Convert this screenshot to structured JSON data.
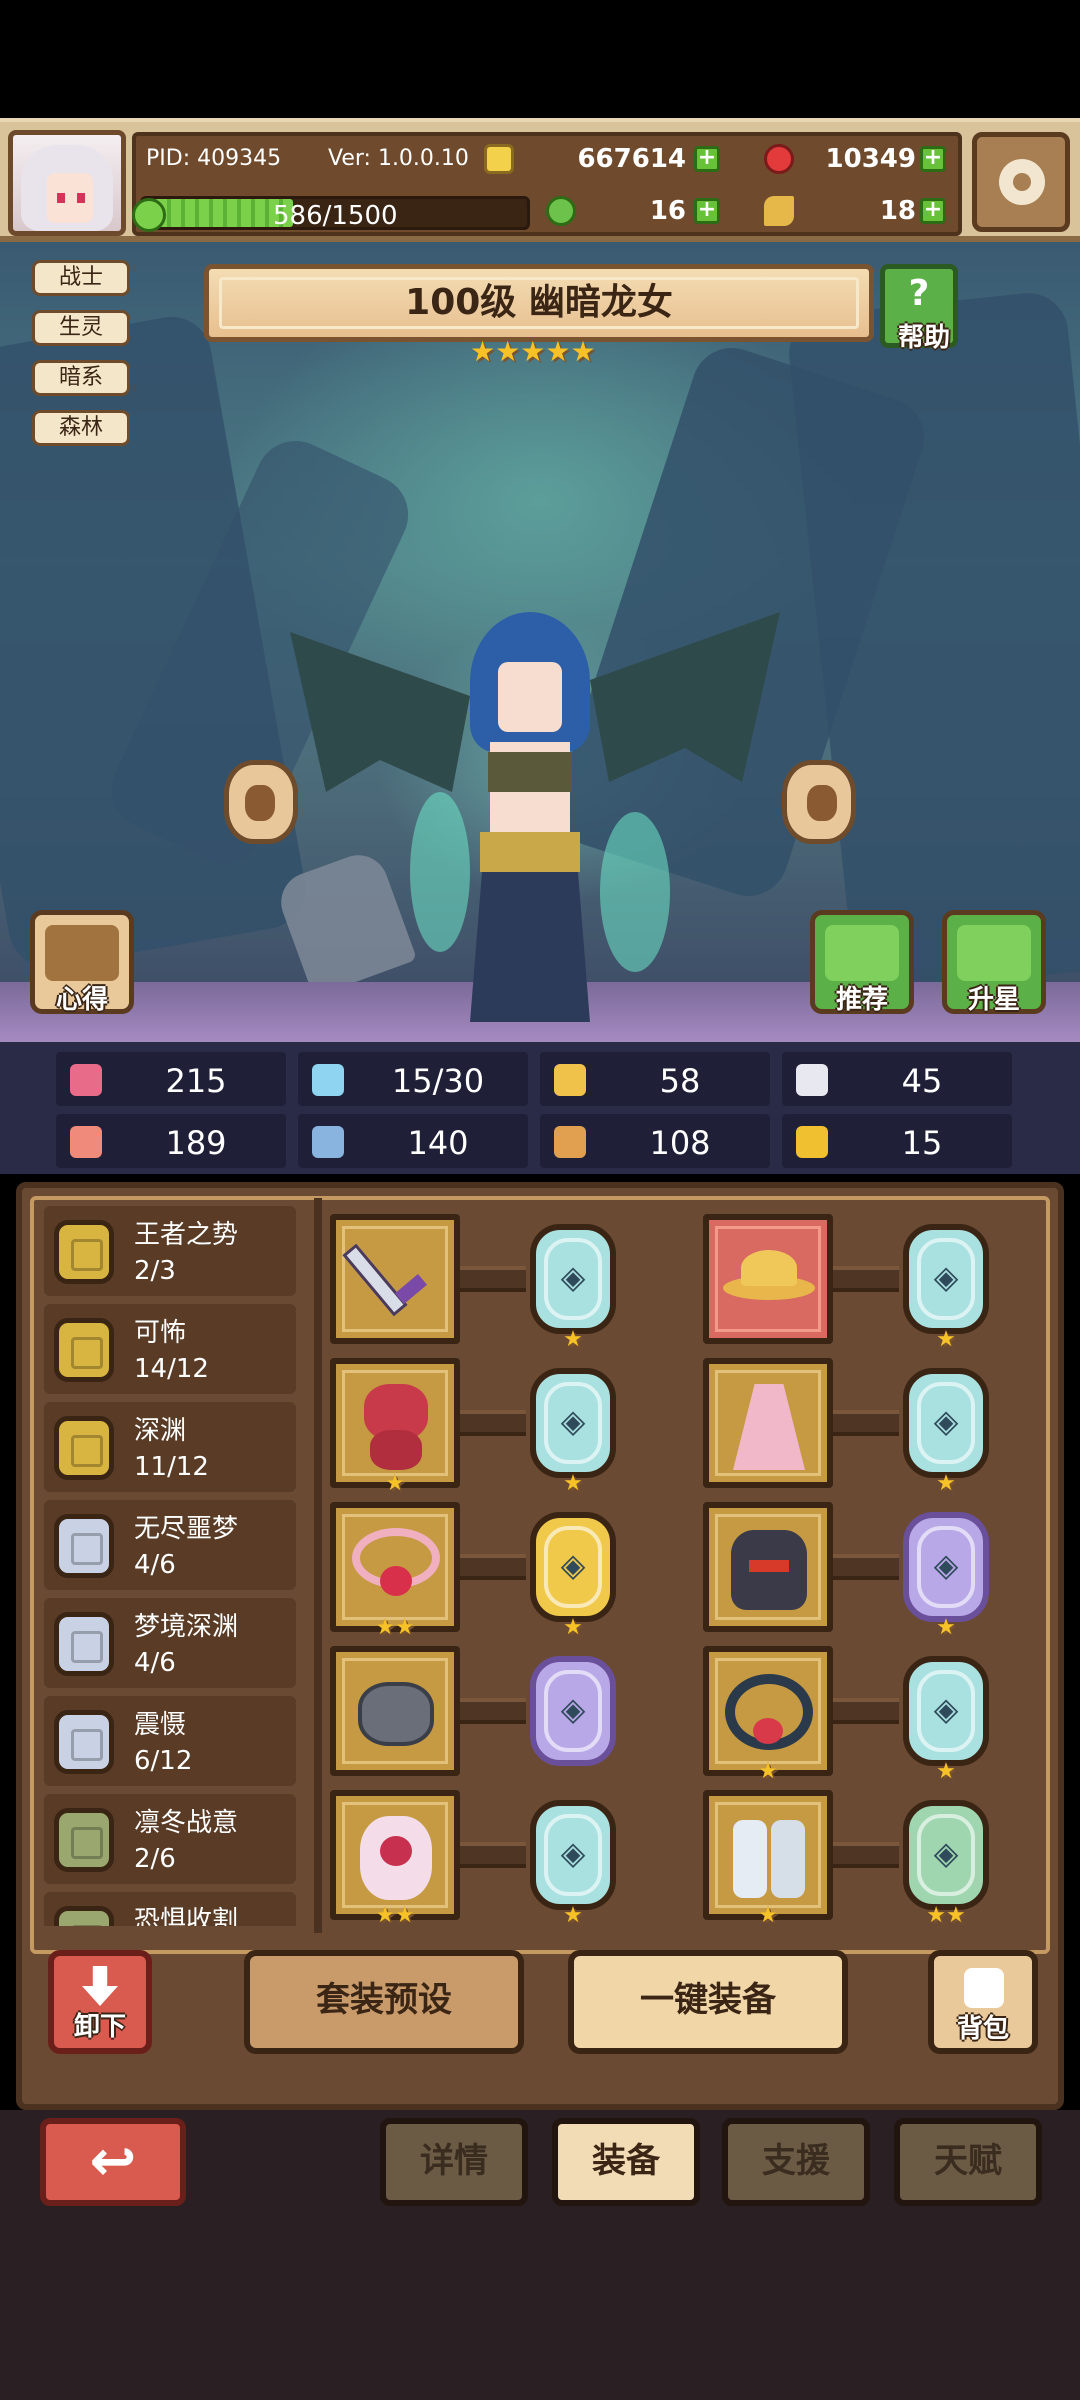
{
  "topbar": {
    "pid": "PID: 409345",
    "version": "Ver: 1.0.0.10",
    "gold": "667614",
    "gems": "10349",
    "exp_text": "586/1500",
    "exp_progress": 0.39,
    "clover": "16",
    "scroll": "18"
  },
  "hero": {
    "tags": [
      "战士",
      "生灵",
      "暗系",
      "森林"
    ],
    "title": "100级 幽暗龙女",
    "stars": 5,
    "help_label": "帮助",
    "notes_label": "心得",
    "recommend_label": "推荐",
    "starup_label": "升星"
  },
  "stats": [
    {
      "icon": "heart-icon",
      "value": "215",
      "color": "#e86b8a"
    },
    {
      "icon": "mana-drop-icon",
      "value": "15/30",
      "color": "#8fd4f0"
    },
    {
      "icon": "shield-icon",
      "value": "58",
      "color": "#f0c24a"
    },
    {
      "icon": "wing-icon",
      "value": "45",
      "color": "#e8e8f0"
    },
    {
      "icon": "fist-icon",
      "value": "189",
      "color": "#f08a7a"
    },
    {
      "icon": "book-icon",
      "value": "140",
      "color": "#8ab4e0"
    },
    {
      "icon": "boot-icon",
      "value": "108",
      "color": "#e0a050"
    },
    {
      "icon": "horseshoe-icon",
      "value": "15",
      "color": "#f0c030"
    }
  ],
  "sets": [
    {
      "name": "王者之势",
      "progress": "2/3",
      "medal": "gold"
    },
    {
      "name": "可怖",
      "progress": "14/12",
      "medal": "gold"
    },
    {
      "name": "深渊",
      "progress": "11/12",
      "medal": "gold"
    },
    {
      "name": "无尽噩梦",
      "progress": "4/6",
      "medal": "silver"
    },
    {
      "name": "梦境深渊",
      "progress": "4/6",
      "medal": "silver"
    },
    {
      "name": "震慑",
      "progress": "6/12",
      "medal": "silver"
    },
    {
      "name": "凛冬战意",
      "progress": "2/6",
      "medal": "green"
    },
    {
      "name": "恐惧收割",
      "progress": "",
      "medal": "green"
    }
  ],
  "equipment": [
    {
      "item": "sword",
      "item_stars": 0,
      "gem": "ice",
      "gem_stars": 1
    },
    {
      "item": "straw-hat",
      "item_stars": 0,
      "gem": "ice",
      "gem_stars": 1
    },
    {
      "item": "teddy-bear",
      "item_stars": 1,
      "gem": "ice",
      "gem_stars": 1
    },
    {
      "item": "pink-dress",
      "item_stars": 0,
      "gem": "ice",
      "gem_stars": 1
    },
    {
      "item": "heart-necklace",
      "item_stars": 2,
      "gem": "gold",
      "gem_stars": 1
    },
    {
      "item": "demon-helm",
      "item_stars": 0,
      "gem": "purple",
      "gem_stars": 1
    },
    {
      "item": "stone",
      "item_stars": 0,
      "gem": "purple",
      "gem_stars": 0
    },
    {
      "item": "rose-ring",
      "item_stars": 1,
      "gem": "ice",
      "gem_stars": 1
    },
    {
      "item": "heart-amulet",
      "item_stars": 2,
      "gem": "ice",
      "gem_stars": 1
    },
    {
      "item": "boots",
      "item_stars": 1,
      "gem": "green",
      "gem_stars": 2
    }
  ],
  "actions": {
    "unequip_label": "卸下",
    "preset_label": "套装预设",
    "auto_equip_label": "一键装备",
    "backpack_label": "背包"
  },
  "tabs": [
    "详情",
    "装备",
    "支援",
    "天赋"
  ],
  "active_tab": "装备"
}
